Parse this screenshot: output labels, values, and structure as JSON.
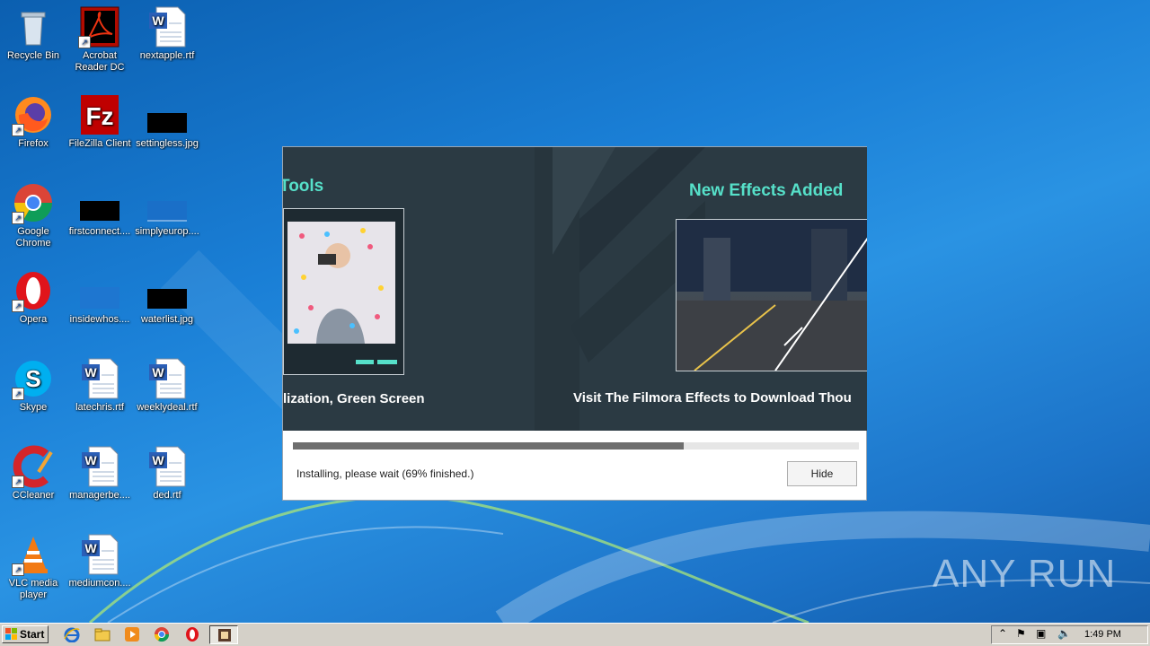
{
  "desktop_icons": [
    {
      "label": "Recycle Bin",
      "icon": "recycle-bin-icon"
    },
    {
      "label": "Acrobat Reader DC",
      "icon": "acrobat-icon"
    },
    {
      "label": "nextapple.rtf",
      "icon": "word-doc-icon"
    },
    {
      "label": "Firefox",
      "icon": "firefox-icon"
    },
    {
      "label": "FileZilla Client",
      "icon": "filezilla-icon"
    },
    {
      "label": "settingless.jpg",
      "icon": "image-file-icon"
    },
    {
      "label": "Google Chrome",
      "icon": "chrome-icon"
    },
    {
      "label": "firstconnect....",
      "icon": "file-icon"
    },
    {
      "label": "simplyeurop....",
      "icon": "file-icon"
    },
    {
      "label": "Opera",
      "icon": "opera-icon"
    },
    {
      "label": "insidewhos....",
      "icon": "file-icon"
    },
    {
      "label": "waterlist.jpg",
      "icon": "image-file-icon"
    },
    {
      "label": "Skype",
      "icon": "skype-icon"
    },
    {
      "label": "latechris.rtf",
      "icon": "word-doc-icon"
    },
    {
      "label": "weeklydeal.rtf",
      "icon": "word-doc-icon"
    },
    {
      "label": "CCleaner",
      "icon": "ccleaner-icon"
    },
    {
      "label": "managerbe....",
      "icon": "word-doc-icon"
    },
    {
      "label": "ded.rtf",
      "icon": "word-doc-icon"
    },
    {
      "label": "VLC media player",
      "icon": "vlc-icon"
    },
    {
      "label": "mediumcon....",
      "icon": "word-doc-icon"
    }
  ],
  "installer": {
    "banner": {
      "title_left": "Tools",
      "title_right": "New Effects Added",
      "subtitle_left": "lization, Green Screen",
      "subtitle_right": "Visit The Filmora Effects to Download Thou"
    },
    "progress_fraction": 0.69,
    "status": "Installing, please wait (69% finished.)",
    "hide_label": "Hide"
  },
  "taskbar": {
    "start_label": "Start",
    "clock": "1:49 PM",
    "icons": [
      "ie-icon",
      "explorer-icon",
      "media-player-icon",
      "chrome-icon",
      "opera-icon",
      "installer-icon"
    ]
  },
  "watermark": "ANY RUN"
}
